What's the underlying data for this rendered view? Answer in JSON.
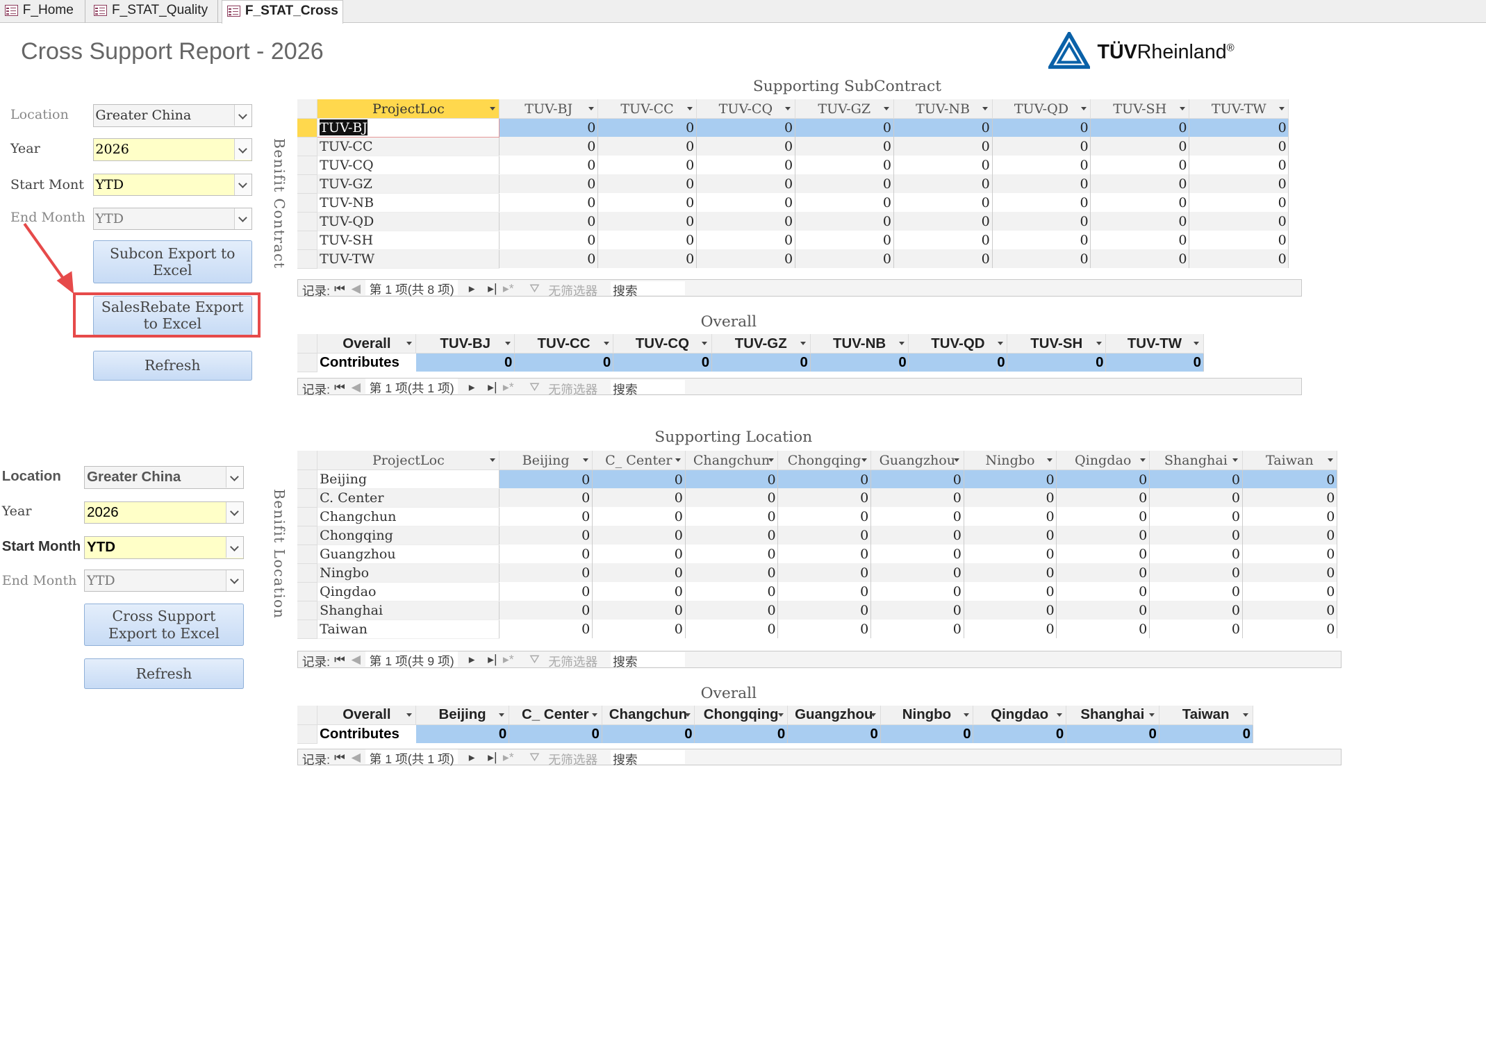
{
  "tabs": [
    "F_Home",
    "F_STAT_Quality",
    "F_STAT_Cross"
  ],
  "title": "Cross Support Report -  2026",
  "logo": {
    "text_bold": "TÜV",
    "text_rest": "Rheinland",
    "reg": "®"
  },
  "form1": {
    "location_label": "Location",
    "location_value": "Greater China",
    "year_label": "Year",
    "year_value": "2026",
    "start_label": "Start Mont",
    "start_value": "YTD",
    "end_label": "End Month",
    "end_value": "YTD",
    "subcon_button": "Subcon Export to Excel",
    "salesrebate_button": "SalesRebate Export to Excel",
    "refresh_button": "Refresh"
  },
  "form2": {
    "location_label": "Location",
    "location_value": "Greater China",
    "year_label": "Year",
    "year_value": "2026",
    "start_label": "Start Month",
    "start_value": "YTD",
    "end_label": "End Month",
    "end_value": "YTD",
    "cross_button": "Cross Support Export to Excel",
    "refresh_button": "Refresh"
  },
  "sub": {
    "caption": "Supporting SubContract",
    "vlabel": "Benifit Contract",
    "columns": [
      "ProjectLoc",
      "TUV-BJ",
      "TUV-CC",
      "TUV-CQ",
      "TUV-GZ",
      "TUV-NB",
      "TUV-QD",
      "TUV-SH",
      "TUV-TW"
    ],
    "rows": [
      {
        "label": "TUV-BJ",
        "values": [
          0,
          0,
          0,
          0,
          0,
          0,
          0,
          0
        ]
      },
      {
        "label": "TUV-CC",
        "values": [
          0,
          0,
          0,
          0,
          0,
          0,
          0,
          0
        ]
      },
      {
        "label": "TUV-CQ",
        "values": [
          0,
          0,
          0,
          0,
          0,
          0,
          0,
          0
        ]
      },
      {
        "label": "TUV-GZ",
        "values": [
          0,
          0,
          0,
          0,
          0,
          0,
          0,
          0
        ]
      },
      {
        "label": "TUV-NB",
        "values": [
          0,
          0,
          0,
          0,
          0,
          0,
          0,
          0
        ]
      },
      {
        "label": "TUV-QD",
        "values": [
          0,
          0,
          0,
          0,
          0,
          0,
          0,
          0
        ]
      },
      {
        "label": "TUV-SH",
        "values": [
          0,
          0,
          0,
          0,
          0,
          0,
          0,
          0
        ]
      },
      {
        "label": "TUV-TW",
        "values": [
          0,
          0,
          0,
          0,
          0,
          0,
          0,
          0
        ]
      }
    ],
    "nav": {
      "record": "记录:",
      "position": "第 1 项(共 8 项)",
      "filter": "无筛选器",
      "search": "搜索"
    }
  },
  "sub_overall": {
    "caption": "Overall",
    "columns": [
      "Overall",
      "TUV-BJ",
      "TUV-CC",
      "TUV-CQ",
      "TUV-GZ",
      "TUV-NB",
      "TUV-QD",
      "TUV-SH",
      "TUV-TW"
    ],
    "row_label": "Contributes",
    "values": [
      0,
      0,
      0,
      0,
      0,
      0,
      0,
      0
    ],
    "nav": {
      "record": "记录:",
      "position": "第 1 项(共 1 项)",
      "filter": "无筛选器",
      "search": "搜索"
    }
  },
  "loc": {
    "caption": "Supporting Location",
    "vlabel": "Benifit Location",
    "columns": [
      "ProjectLoc",
      "Beijing",
      "C_ Center",
      "Changchun",
      "Chongqing",
      "Guangzhou",
      "Ningbo",
      "Qingdao",
      "Shanghai",
      "Taiwan"
    ],
    "rows": [
      {
        "label": "Beijing",
        "values": [
          0,
          0,
          0,
          0,
          0,
          0,
          0,
          0,
          0
        ]
      },
      {
        "label": "C. Center",
        "values": [
          0,
          0,
          0,
          0,
          0,
          0,
          0,
          0,
          0
        ]
      },
      {
        "label": "Changchun",
        "values": [
          0,
          0,
          0,
          0,
          0,
          0,
          0,
          0,
          0
        ]
      },
      {
        "label": "Chongqing",
        "values": [
          0,
          0,
          0,
          0,
          0,
          0,
          0,
          0,
          0
        ]
      },
      {
        "label": "Guangzhou",
        "values": [
          0,
          0,
          0,
          0,
          0,
          0,
          0,
          0,
          0
        ]
      },
      {
        "label": "Ningbo",
        "values": [
          0,
          0,
          0,
          0,
          0,
          0,
          0,
          0,
          0
        ]
      },
      {
        "label": "Qingdao",
        "values": [
          0,
          0,
          0,
          0,
          0,
          0,
          0,
          0,
          0
        ]
      },
      {
        "label": "Shanghai",
        "values": [
          0,
          0,
          0,
          0,
          0,
          0,
          0,
          0,
          0
        ]
      },
      {
        "label": "Taiwan",
        "values": [
          0,
          0,
          0,
          0,
          0,
          0,
          0,
          0,
          0
        ]
      }
    ],
    "nav": {
      "record": "记录:",
      "position": "第 1 项(共 9 项)",
      "filter": "无筛选器",
      "search": "搜索"
    }
  },
  "loc_overall": {
    "caption": "Overall",
    "columns": [
      "Overall",
      "Beijing",
      "C_ Center",
      "Changchun",
      "Chongqing",
      "Guangzhou",
      "Ningbo",
      "Qingdao",
      "Shanghai",
      "Taiwan"
    ],
    "row_label": "Contributes",
    "values": [
      0,
      0,
      0,
      0,
      0,
      0,
      0,
      0,
      0
    ],
    "nav": {
      "record": "记录:",
      "position": "第 1 项(共 1 项)",
      "filter": "无筛选器",
      "search": "搜索"
    }
  }
}
